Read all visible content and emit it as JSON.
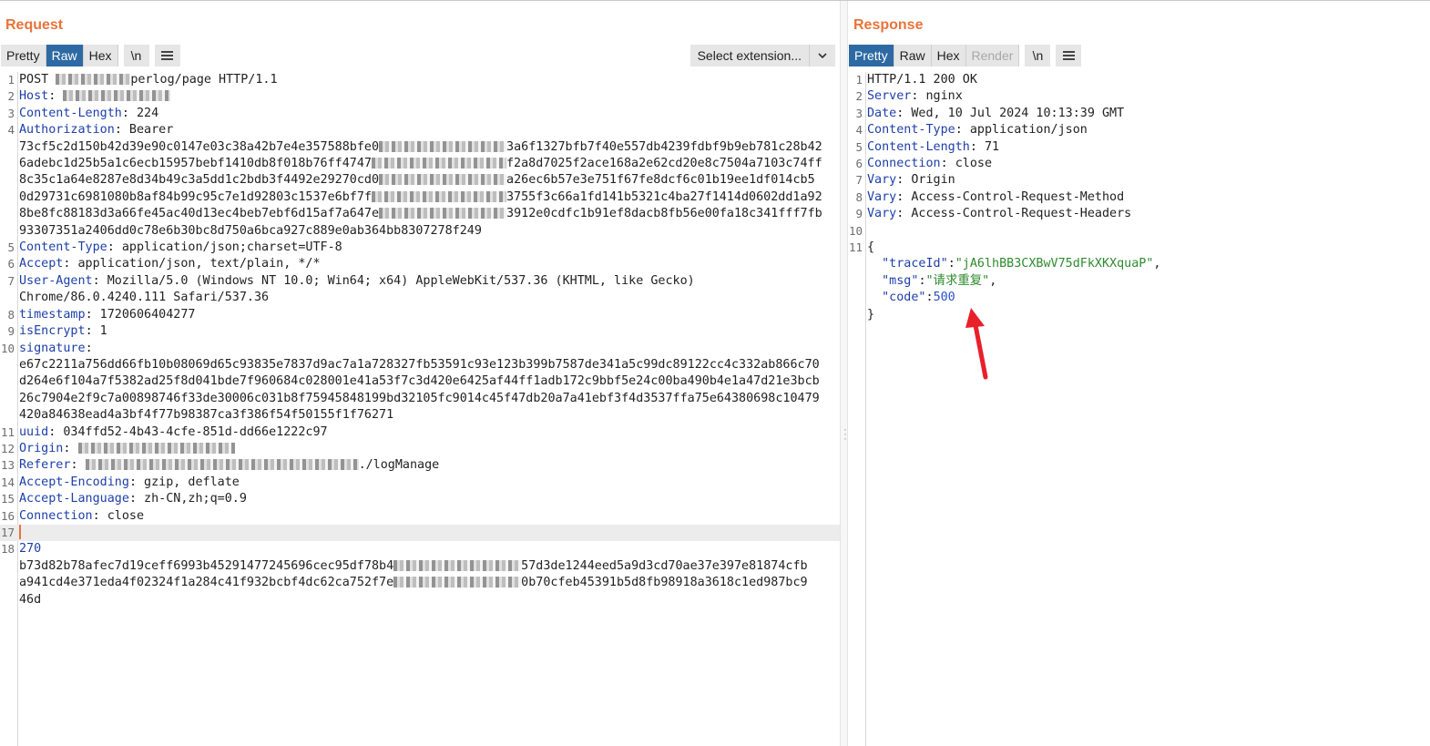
{
  "request": {
    "title": "Request",
    "tabs": [
      "Pretty",
      "Raw",
      "Hex"
    ],
    "active_tab": "Raw",
    "newline_btn": "\\n",
    "extension_select": "Select extension...",
    "lines": [
      {
        "n": "1",
        "parts": [
          {
            "t": "POST ",
            "c": "hval"
          },
          {
            "blur": 82
          },
          {
            "t": "perlog/page HTTP/1.1",
            "c": "hval"
          }
        ]
      },
      {
        "n": "2",
        "parts": [
          {
            "t": "Host",
            "c": "key"
          },
          {
            "t": ": ",
            "c": "hval"
          },
          {
            "blur": 118
          }
        ]
      },
      {
        "n": "3",
        "parts": [
          {
            "t": "Content-Length",
            "c": "key"
          },
          {
            "t": ": 224",
            "c": "hval"
          }
        ]
      },
      {
        "n": "4",
        "parts": [
          {
            "t": "Authorization",
            "c": "key"
          },
          {
            "t": ": Bearer",
            "c": "hval"
          }
        ]
      },
      {
        "n": "",
        "parts": [
          {
            "t": "73cf5c2d150b42d39e90c0147e03c38a42b7e4e357588bfe0",
            "c": "hval"
          },
          {
            "blur": 140
          },
          {
            "t": "3a6f1327bfb7f40e557db4239fdbf9b9eb781c28b42",
            "c": "hval"
          }
        ]
      },
      {
        "n": "",
        "parts": [
          {
            "t": "6adebc1d25b5a1c6ecb15957bebf1410db8f018b76ff4747",
            "c": "hval"
          },
          {
            "blur": 148
          },
          {
            "t": "f2a8d7025f2ace168a2e62cd20e8c7504a7103c74ff",
            "c": "hval"
          }
        ]
      },
      {
        "n": "",
        "parts": [
          {
            "t": "8c35c1a64e8287e8d34b49c3a5dd1c2bdb3f4492e29270cd0",
            "c": "hval"
          },
          {
            "blur": 140
          },
          {
            "t": "a26ec6b57e3e751f67fe8dcf6c01b19ee1df014cb5",
            "c": "hval"
          }
        ]
      },
      {
        "n": "",
        "parts": [
          {
            "t": "0d29731c6981080b8af84b99c95c7e1d92803c1537e6bf7f",
            "c": "hval"
          },
          {
            "blur": 148
          },
          {
            "t": "3755f3c66a1fd141b5321c4ba27f1414d0602dd1a92",
            "c": "hval"
          }
        ]
      },
      {
        "n": "",
        "parts": [
          {
            "t": "8be8fc88183d3a66fe45ac40d13ec4beb7ebf6d15af7a647e",
            "c": "hval"
          },
          {
            "blur": 140
          },
          {
            "t": "3912e0cdfc1b91ef8dacb8fb56e00fa18c341fff7fb",
            "c": "hval"
          }
        ]
      },
      {
        "n": "",
        "parts": [
          {
            "t": "93307351a2406dd0c78e6b30bc8d750a6bca927c889e0ab364bb8307278f249",
            "c": "hval"
          }
        ]
      },
      {
        "n": "5",
        "parts": [
          {
            "t": "Content-Type",
            "c": "key"
          },
          {
            "t": ": application/json;charset=UTF-8",
            "c": "hval"
          }
        ]
      },
      {
        "n": "6",
        "parts": [
          {
            "t": "Accept",
            "c": "key"
          },
          {
            "t": ": application/json, text/plain, */*",
            "c": "hval"
          }
        ]
      },
      {
        "n": "7",
        "parts": [
          {
            "t": "User-Agent",
            "c": "key"
          },
          {
            "t": ": Mozilla/5.0 (Windows NT 10.0; Win64; x64) AppleWebKit/537.36 (KHTML, like Gecko)",
            "c": "hval"
          }
        ]
      },
      {
        "n": "",
        "parts": [
          {
            "t": "Chrome/86.0.4240.111 Safari/537.36",
            "c": "hval"
          }
        ]
      },
      {
        "n": "8",
        "parts": [
          {
            "t": "timestamp",
            "c": "key"
          },
          {
            "t": ": 1720606404277",
            "c": "hval"
          }
        ]
      },
      {
        "n": "9",
        "parts": [
          {
            "t": "isEncrypt",
            "c": "key"
          },
          {
            "t": ": 1",
            "c": "hval"
          }
        ]
      },
      {
        "n": "10",
        "parts": [
          {
            "t": "signature",
            "c": "key"
          },
          {
            "t": ":",
            "c": "hval"
          }
        ]
      },
      {
        "n": "",
        "parts": [
          {
            "t": "e67c2211a756dd66fb10b08069d65c93835e7837d9ac7a1a728327fb53591c93e123b399b7587de341a5c99dc89122cc4c332ab866c70",
            "c": "hval"
          }
        ]
      },
      {
        "n": "",
        "parts": [
          {
            "t": "d264e6f104a7f5382ad25f8d041bde7f960684c028001e41a53f7c3d420e6425af44ff1adb172c9bbf5e24c00ba490b4e1a47d21e3bcb",
            "c": "hval"
          }
        ]
      },
      {
        "n": "",
        "parts": [
          {
            "t": "26c7904e2f9c7a00898746f33de30006c031b8f75945848199bd32105fc9014c45f47db20a7a41ebf3f4d3537ffa75e64380698c10479",
            "c": "hval"
          }
        ]
      },
      {
        "n": "",
        "parts": [
          {
            "t": "420a84638ead4a3bf4f77b98387ca3f386f54f50155f1f76271",
            "c": "hval"
          }
        ]
      },
      {
        "n": "11",
        "parts": [
          {
            "t": "uuid",
            "c": "key"
          },
          {
            "t": ": 034ffd52-4b43-4cfe-851d-dd66e1222c97",
            "c": "hval"
          }
        ]
      },
      {
        "n": "12",
        "parts": [
          {
            "t": "Origin",
            "c": "key"
          },
          {
            "t": ": ",
            "c": "hval"
          },
          {
            "blur": 172
          }
        ]
      },
      {
        "n": "13",
        "parts": [
          {
            "t": "Referer",
            "c": "key"
          },
          {
            "t": ": ",
            "c": "hval"
          },
          {
            "blur": 300
          },
          {
            "t": "./logManage",
            "c": "hval"
          }
        ]
      },
      {
        "n": "14",
        "parts": [
          {
            "t": "Accept-Encoding",
            "c": "key"
          },
          {
            "t": ": gzip, deflate",
            "c": "hval"
          }
        ]
      },
      {
        "n": "15",
        "parts": [
          {
            "t": "Accept-Language",
            "c": "key"
          },
          {
            "t": ": zh-CN,zh;q=0.9",
            "c": "hval"
          }
        ]
      },
      {
        "n": "16",
        "parts": [
          {
            "t": "Connection",
            "c": "key"
          },
          {
            "t": ": close",
            "c": "hval"
          }
        ]
      },
      {
        "n": "17",
        "parts": [
          {
            "caret": true
          }
        ],
        "cursor": true
      },
      {
        "n": "18",
        "parts": [
          {
            "t": "270",
            "c": "key"
          }
        ]
      },
      {
        "n": "",
        "parts": [
          {
            "t": "b73d82b78afec7d19ceff6993b45291477245696cec95df78b4",
            "c": "hval"
          },
          {
            "blur": 140
          },
          {
            "t": "57d3de1244eed5a9d3cd70ae37e397e81874cfb",
            "c": "hval"
          }
        ]
      },
      {
        "n": "",
        "parts": [
          {
            "t": "a941cd4e371eda4f02324f1a284c41f932bcbf4dc62ca752f7e",
            "c": "hval"
          },
          {
            "blur": 140
          },
          {
            "t": "0b70cfeb45391b5d8fb98918a3618c1ed987bc9",
            "c": "hval"
          }
        ]
      },
      {
        "n": "",
        "parts": [
          {
            "t": "46d",
            "c": "hval"
          }
        ]
      }
    ]
  },
  "response": {
    "title": "Response",
    "tabs": [
      "Pretty",
      "Raw",
      "Hex",
      "Render"
    ],
    "active_tab": "Pretty",
    "disabled_tab": "Render",
    "newline_btn": "\\n",
    "lines": [
      {
        "n": "1",
        "parts": [
          {
            "t": "HTTP/1.1 200 OK",
            "c": "hval"
          }
        ],
        "cursor": true
      },
      {
        "n": "2",
        "parts": [
          {
            "t": "Server",
            "c": "key"
          },
          {
            "t": ": nginx",
            "c": "hval"
          }
        ]
      },
      {
        "n": "3",
        "parts": [
          {
            "t": "Date",
            "c": "key"
          },
          {
            "t": ": Wed, 10 Jul 2024 10:13:39 GMT",
            "c": "hval"
          }
        ]
      },
      {
        "n": "4",
        "parts": [
          {
            "t": "Content-Type",
            "c": "key"
          },
          {
            "t": ": application/json",
            "c": "hval"
          }
        ]
      },
      {
        "n": "5",
        "parts": [
          {
            "t": "Content-Length",
            "c": "key"
          },
          {
            "t": ": 71",
            "c": "hval"
          }
        ]
      },
      {
        "n": "6",
        "parts": [
          {
            "t": "Connection",
            "c": "key"
          },
          {
            "t": ": close",
            "c": "hval"
          }
        ]
      },
      {
        "n": "7",
        "parts": [
          {
            "t": "Vary",
            "c": "key"
          },
          {
            "t": ": Origin",
            "c": "hval"
          }
        ]
      },
      {
        "n": "8",
        "parts": [
          {
            "t": "Vary",
            "c": "key"
          },
          {
            "t": ": Access-Control-Request-Method",
            "c": "hval"
          }
        ]
      },
      {
        "n": "9",
        "parts": [
          {
            "t": "Vary",
            "c": "key"
          },
          {
            "t": ": Access-Control-Request-Headers",
            "c": "hval"
          }
        ]
      },
      {
        "n": "10",
        "parts": []
      },
      {
        "n": "11",
        "parts": [
          {
            "t": "{",
            "c": "hval"
          }
        ]
      },
      {
        "n": "",
        "parts": [
          {
            "t": "  ",
            "c": "hval"
          },
          {
            "t": "\"traceId\"",
            "c": "jkey"
          },
          {
            "t": ":",
            "c": "hval"
          },
          {
            "t": "\"jA6lhBB3CXBwV75dFkXKXquaP\"",
            "c": "jstr"
          },
          {
            "t": ",",
            "c": "hval"
          }
        ]
      },
      {
        "n": "",
        "parts": [
          {
            "t": "  ",
            "c": "hval"
          },
          {
            "t": "\"msg\"",
            "c": "jkey"
          },
          {
            "t": ":",
            "c": "hval"
          },
          {
            "t": "\"请求重复\"",
            "c": "jstr"
          },
          {
            "t": ",",
            "c": "hval"
          }
        ]
      },
      {
        "n": "",
        "parts": [
          {
            "t": "  ",
            "c": "hval"
          },
          {
            "t": "\"code\"",
            "c": "jkey"
          },
          {
            "t": ":",
            "c": "hval"
          },
          {
            "t": "500",
            "c": "jnum"
          }
        ]
      },
      {
        "n": "",
        "parts": [
          {
            "t": "}",
            "c": "hval"
          }
        ]
      }
    ]
  },
  "colors": {
    "accent": "#e8743b",
    "active_tab": "#2d6aa3",
    "header_key": "#1e3fa8",
    "json_string": "#2e8b2e",
    "json_number": "#2a4fd1",
    "arrow": "#e8202a"
  },
  "icons": {
    "menu": "hamburger-icon",
    "chevron": "chevron-down-icon",
    "annotation": "red-arrow-icon"
  }
}
